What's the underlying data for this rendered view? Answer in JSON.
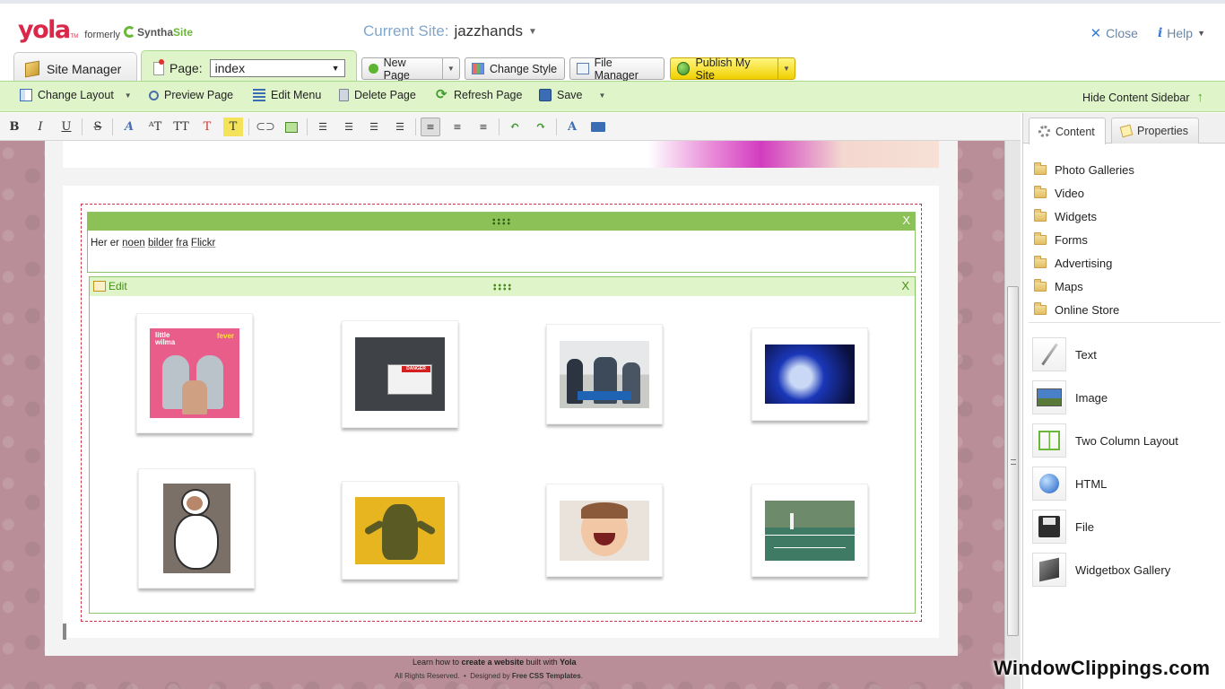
{
  "header": {
    "logo_text": "yola",
    "logo_tm": "TM",
    "formerly": "formerly",
    "synthasite_synth": "Syntha",
    "synthasite_site": "Site",
    "current_site_label": "Current Site:",
    "current_site_name": "jazzhands",
    "close_label": "Close",
    "help_label": "Help"
  },
  "tabs": {
    "site_manager": "Site Manager",
    "page_label": "Page:",
    "page_value": "index"
  },
  "buttons": {
    "new_page": "New Page",
    "change_style": "Change Style",
    "file_manager": "File Manager",
    "publish": "Publish My Site"
  },
  "action_bar": {
    "change_layout": "Change Layout",
    "preview_page": "Preview Page",
    "edit_menu": "Edit Menu",
    "delete_page": "Delete Page",
    "refresh_page": "Refresh Page",
    "save": "Save",
    "hide_sidebar": "Hide Content Sidebar"
  },
  "format_bar": {
    "bold": "B",
    "italic": "I",
    "underline": "U",
    "strike": "S"
  },
  "content": {
    "text_widget_pre": "Her er ",
    "text_widget_u1": "noen",
    "text_widget_sp1": " ",
    "text_widget_u2": "bilder",
    "text_widget_sp2": " ",
    "text_widget_u3": "fra",
    "text_widget_sp3": " ",
    "text_widget_u4": "Flickr",
    "edit_label": "Edit",
    "close_x": "X",
    "album_title_1": "little",
    "album_title_2": "wilma",
    "album_title_3": "fever",
    "sign_text": "DANGER"
  },
  "footer": {
    "line1_a": "Learn how to ",
    "line1_b": "create a website",
    "line1_c": " built with ",
    "line1_d": "Yola",
    "line2_a": "All Rights Reserved.",
    "line2_sep": "•",
    "line2_b": "Designed by ",
    "line2_c": "Free CSS Templates",
    "line2_d": "."
  },
  "sidebar": {
    "tab_content": "Content",
    "tab_properties": "Properties",
    "folders": [
      "Photo Galleries",
      "Video",
      "Widgets",
      "Forms",
      "Advertising",
      "Maps",
      "Online Store"
    ],
    "elements": [
      "Text",
      "Image",
      "Two Column Layout",
      "HTML",
      "File",
      "Widgetbox Gallery"
    ]
  },
  "watermark": "WindowClippings.com",
  "colors": {
    "accent_green": "#8bc157",
    "light_green": "#dff5c9",
    "yola_red": "#d9284a",
    "canvas_bg": "#b98e99",
    "publish_yellow": "#f0d000"
  }
}
